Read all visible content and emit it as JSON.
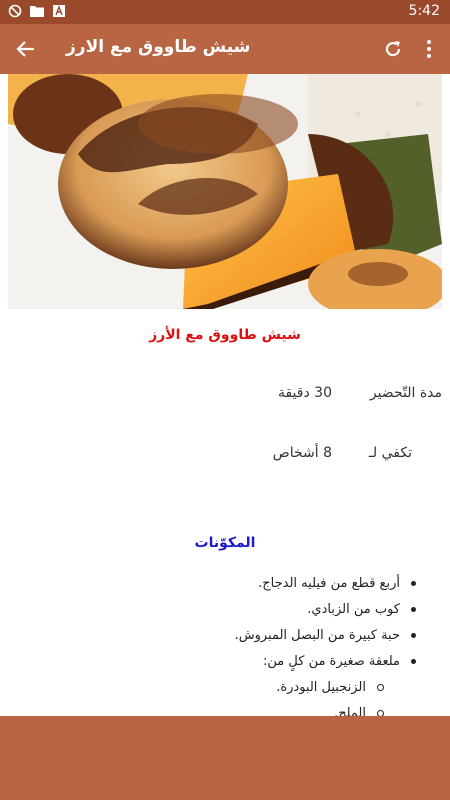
{
  "status_bar": {
    "time": "5:42",
    "icons": [
      "no-disturb-icon",
      "folder-icon",
      "font-a-icon"
    ]
  },
  "app_bar": {
    "title": "شيش طاووق مع الارز",
    "back_icon": "back-arrow-icon",
    "refresh_icon": "refresh-icon",
    "more_icon": "more-vert-icon"
  },
  "recipe": {
    "name": "شيش طاووق مع الأرز",
    "prep_label": "مدة التّحضير",
    "prep_value": "30 دقيقة",
    "serves_label": "تكفي لـ",
    "serves_value": "8 أشخاص",
    "ingredients_heading": "المكوّنات",
    "ingredients": [
      "أربع قطع من فيليه الدجاج.",
      "كوب من الزبادي.",
      "حبة كبيرة من البصل المبروش.",
      "ملعقة صغيرة من كلٍ من:"
    ],
    "sub_ingredients": [
      "الزنجبيل البودرة.",
      "الملح."
    ]
  },
  "colors": {
    "status_bar": "#9a4a2b",
    "app_bar": "#b96544",
    "recipe_title": "#e01010",
    "section_heading": "#1a1acb"
  }
}
